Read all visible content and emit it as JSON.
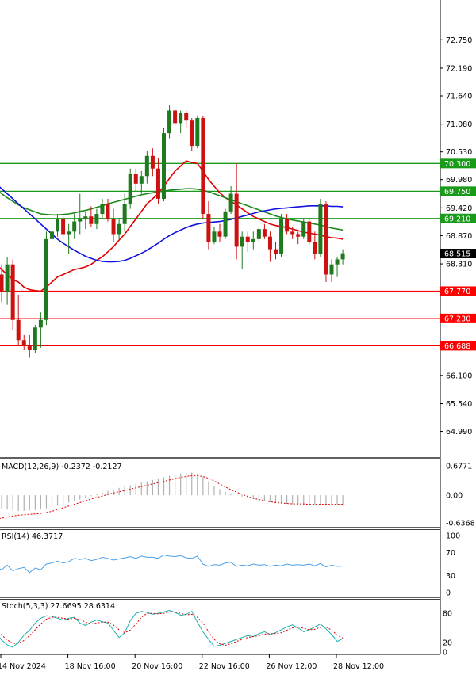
{
  "chart_data": {
    "type": "candlestick",
    "colors": {
      "up": "#1f7a1f",
      "down": "#cc1111",
      "support": "#ff0000",
      "resistance": "#1a9a1a",
      "ma_fast": "#e00000",
      "ma_slow": "#1a8a1a",
      "ma_blue": "#1010dd",
      "macd_hist": "#b0b0b0",
      "macd_signal": "#e00000",
      "rsi": "#4aa0e8",
      "stoch_main": "#1ab0b0",
      "stoch_signal": "#e00000"
    },
    "price_axis": {
      "ticks": [
        "72.750",
        "72.190",
        "71.640",
        "71.080",
        "70.530",
        "69.980",
        "69.420",
        "68.870",
        "68.310",
        "66.100",
        "65.540",
        "64.990"
      ],
      "tick_values": [
        72.75,
        72.19,
        71.64,
        71.08,
        70.53,
        69.98,
        69.42,
        68.87,
        68.31,
        66.1,
        65.54,
        64.99
      ],
      "range": [
        64.7,
        73.1
      ]
    },
    "current_price": {
      "label": "68.515",
      "value": 68.515
    },
    "levels": [
      {
        "label": "70.300",
        "value": 70.3,
        "kind": "resistance"
      },
      {
        "label": "69.750",
        "value": 69.75,
        "kind": "resistance"
      },
      {
        "label": "69.210",
        "value": 69.21,
        "kind": "resistance"
      },
      {
        "label": "67.770",
        "value": 67.77,
        "kind": "support"
      },
      {
        "label": "67.230",
        "value": 67.23,
        "kind": "support"
      },
      {
        "label": "66.688",
        "value": 66.688,
        "kind": "support"
      }
    ],
    "x_labels": [
      "14 Nov 2024",
      "18 Nov 16:00",
      "20 Nov 16:00",
      "22 Nov 16:00",
      "26 Nov 12:00",
      "28 Nov 12:00"
    ],
    "x_label_index": [
      0,
      12,
      24,
      36,
      48,
      60
    ],
    "candles": [
      [
        68.4,
        68.55,
        67.95,
        68.1
      ],
      [
        68.1,
        68.3,
        67.55,
        67.75
      ],
      [
        67.75,
        68.45,
        67.5,
        68.3
      ],
      [
        68.3,
        68.4,
        67.0,
        67.2
      ],
      [
        67.2,
        67.7,
        66.7,
        66.8
      ],
      [
        66.8,
        66.9,
        66.6,
        66.7
      ],
      [
        66.7,
        66.9,
        66.45,
        66.6
      ],
      [
        66.6,
        67.1,
        66.55,
        67.05
      ],
      [
        67.05,
        67.35,
        66.65,
        67.2
      ],
      [
        67.2,
        68.95,
        67.1,
        68.8
      ],
      [
        68.8,
        69.15,
        68.7,
        68.95
      ],
      [
        68.95,
        69.3,
        68.85,
        69.2
      ],
      [
        69.2,
        69.3,
        68.8,
        68.9
      ],
      [
        68.9,
        69.1,
        68.5,
        68.95
      ],
      [
        68.95,
        69.3,
        68.8,
        69.15
      ],
      [
        69.15,
        69.7,
        68.9,
        69.2
      ],
      [
        69.2,
        69.35,
        69.0,
        69.25
      ],
      [
        69.25,
        69.45,
        69.05,
        69.1
      ],
      [
        69.1,
        69.4,
        69.0,
        69.3
      ],
      [
        69.3,
        69.6,
        69.2,
        69.5
      ],
      [
        69.5,
        69.6,
        69.15,
        69.2
      ],
      [
        69.2,
        69.4,
        68.75,
        68.9
      ],
      [
        68.9,
        69.2,
        68.8,
        69.1
      ],
      [
        69.1,
        69.7,
        68.95,
        69.5
      ],
      [
        69.5,
        70.2,
        69.4,
        70.1
      ],
      [
        70.1,
        70.2,
        69.75,
        69.9
      ],
      [
        69.9,
        70.15,
        69.7,
        70.05
      ],
      [
        70.05,
        70.55,
        69.9,
        70.45
      ],
      [
        70.45,
        70.6,
        70.05,
        70.2
      ],
      [
        70.2,
        70.4,
        69.5,
        69.6
      ],
      [
        69.6,
        71.0,
        69.55,
        70.9
      ],
      [
        70.9,
        71.45,
        70.8,
        71.35
      ],
      [
        71.35,
        71.4,
        71.05,
        71.1
      ],
      [
        71.1,
        71.35,
        70.9,
        71.3
      ],
      [
        71.3,
        71.35,
        71.0,
        71.15
      ],
      [
        71.15,
        71.2,
        70.55,
        70.65
      ],
      [
        70.65,
        71.25,
        70.6,
        71.2
      ],
      [
        71.2,
        71.25,
        69.2,
        69.3
      ],
      [
        69.3,
        69.55,
        68.6,
        68.75
      ],
      [
        68.75,
        69.05,
        68.7,
        68.95
      ],
      [
        68.95,
        69.1,
        68.75,
        68.85
      ],
      [
        68.85,
        69.4,
        68.8,
        69.35
      ],
      [
        69.35,
        69.85,
        69.3,
        69.7
      ],
      [
        69.7,
        70.3,
        68.4,
        68.65
      ],
      [
        68.65,
        68.95,
        68.2,
        68.85
      ],
      [
        68.85,
        68.95,
        68.55,
        68.75
      ],
      [
        68.75,
        68.95,
        68.6,
        68.8
      ],
      [
        68.8,
        69.05,
        68.75,
        69.0
      ],
      [
        69.0,
        69.1,
        68.8,
        68.85
      ],
      [
        68.85,
        68.95,
        68.35,
        68.6
      ],
      [
        68.6,
        68.75,
        68.4,
        68.5
      ],
      [
        68.5,
        69.3,
        68.45,
        69.2
      ],
      [
        69.2,
        69.3,
        68.9,
        68.95
      ],
      [
        68.95,
        69.05,
        68.8,
        68.9
      ],
      [
        68.9,
        68.95,
        68.7,
        68.85
      ],
      [
        68.85,
        69.2,
        68.8,
        69.15
      ],
      [
        69.15,
        69.2,
        68.7,
        68.75
      ],
      [
        68.75,
        68.95,
        68.4,
        68.5
      ],
      [
        68.5,
        69.6,
        68.45,
        69.5
      ],
      [
        69.5,
        69.55,
        67.95,
        68.1
      ],
      [
        68.1,
        68.4,
        67.95,
        68.3
      ],
      [
        68.3,
        68.45,
        68.05,
        68.4
      ],
      [
        68.4,
        68.6,
        68.3,
        68.52
      ]
    ],
    "ma_fast": [
      68.3,
      68.2,
      68.1,
      68.0,
      67.95,
      67.85,
      67.8,
      67.78,
      67.77,
      67.85,
      67.95,
      68.05,
      68.1,
      68.15,
      68.2,
      68.22,
      68.25,
      68.3,
      68.38,
      68.45,
      68.55,
      68.65,
      68.78,
      68.9,
      69.05,
      69.2,
      69.35,
      69.5,
      69.6,
      69.7,
      69.85,
      70.0,
      70.15,
      70.25,
      70.35,
      70.32,
      70.3,
      70.15,
      69.98,
      69.85,
      69.72,
      69.62,
      69.55,
      69.48,
      69.4,
      69.32,
      69.25,
      69.2,
      69.15,
      69.1,
      69.07,
      69.05,
      69.03,
      69.0,
      68.97,
      68.94,
      68.92,
      68.9,
      68.88,
      68.85,
      68.83,
      68.82,
      68.8
    ],
    "ma_slow": [
      69.8,
      69.7,
      69.62,
      69.55,
      69.48,
      69.42,
      69.38,
      69.34,
      69.3,
      69.29,
      69.28,
      69.28,
      69.29,
      69.3,
      69.32,
      69.35,
      69.37,
      69.4,
      69.43,
      69.46,
      69.5,
      69.53,
      69.56,
      69.59,
      69.62,
      69.65,
      69.68,
      69.7,
      69.72,
      69.74,
      69.75,
      69.77,
      69.78,
      69.79,
      69.8,
      69.8,
      69.79,
      69.77,
      69.74,
      69.7,
      69.66,
      69.62,
      69.58,
      69.54,
      69.5,
      69.46,
      69.42,
      69.38,
      69.34,
      69.3,
      69.26,
      69.23,
      69.2,
      69.18,
      69.16,
      69.14,
      69.12,
      69.1,
      69.08,
      69.05,
      69.02,
      69.0,
      68.98
    ],
    "ma_blue": [
      69.9,
      69.8,
      69.7,
      69.6,
      69.5,
      69.4,
      69.3,
      69.2,
      69.1,
      69.0,
      68.9,
      68.8,
      68.72,
      68.65,
      68.58,
      68.52,
      68.46,
      68.42,
      68.38,
      68.36,
      68.35,
      68.35,
      68.36,
      68.38,
      68.42,
      68.47,
      68.52,
      68.58,
      68.65,
      68.72,
      68.8,
      68.87,
      68.93,
      68.98,
      69.03,
      69.07,
      69.1,
      69.12,
      69.13,
      69.14,
      69.15,
      69.17,
      69.19,
      69.22,
      69.25,
      69.28,
      69.31,
      69.34,
      69.36,
      69.38,
      69.4,
      69.41,
      69.42,
      69.43,
      69.44,
      69.45,
      69.46,
      69.46,
      69.46,
      69.46,
      69.45,
      69.45,
      69.44
    ],
    "macd": {
      "label": "MACD(12,26,9) -0.2372 -0.2127",
      "ticks": [
        "0.6771",
        "0.00",
        "-0.6368"
      ],
      "tick_values": [
        0.6771,
        0.0,
        -0.6368
      ],
      "histogram": [
        -0.3,
        -0.32,
        -0.33,
        -0.35,
        -0.36,
        -0.36,
        -0.35,
        -0.34,
        -0.33,
        -0.3,
        -0.27,
        -0.24,
        -0.2,
        -0.17,
        -0.14,
        -0.1,
        -0.06,
        -0.02,
        0.02,
        0.06,
        0.1,
        0.14,
        0.17,
        0.2,
        0.23,
        0.26,
        0.29,
        0.32,
        0.35,
        0.38,
        0.41,
        0.45,
        0.48,
        0.5,
        0.52,
        0.52,
        0.5,
        0.42,
        0.32,
        0.22,
        0.14,
        0.08,
        0.04,
        0.0,
        -0.03,
        -0.06,
        -0.09,
        -0.12,
        -0.14,
        -0.16,
        -0.18,
        -0.19,
        -0.2,
        -0.21,
        -0.21,
        -0.22,
        -0.22,
        -0.22,
        -0.22,
        -0.23,
        -0.23,
        -0.23,
        -0.24
      ],
      "signal": [
        -0.55,
        -0.53,
        -0.5,
        -0.48,
        -0.46,
        -0.45,
        -0.44,
        -0.43,
        -0.42,
        -0.4,
        -0.37,
        -0.33,
        -0.29,
        -0.25,
        -0.21,
        -0.17,
        -0.13,
        -0.09,
        -0.05,
        -0.02,
        0.02,
        0.05,
        0.08,
        0.11,
        0.14,
        0.17,
        0.2,
        0.23,
        0.26,
        0.29,
        0.32,
        0.35,
        0.38,
        0.41,
        0.43,
        0.45,
        0.45,
        0.43,
        0.39,
        0.33,
        0.26,
        0.19,
        0.13,
        0.07,
        0.02,
        -0.03,
        -0.07,
        -0.1,
        -0.13,
        -0.15,
        -0.17,
        -0.18,
        -0.19,
        -0.2,
        -0.2,
        -0.2,
        -0.21,
        -0.21,
        -0.21,
        -0.21,
        -0.21,
        -0.21,
        -0.21
      ]
    },
    "rsi": {
      "label": "RSI(14) 46.3717",
      "ticks": [
        "100",
        "70",
        "30",
        "0"
      ],
      "tick_values": [
        100,
        70,
        30,
        0
      ],
      "values": [
        45,
        40,
        48,
        38,
        42,
        44,
        35,
        43,
        40,
        50,
        52,
        55,
        52,
        54,
        60,
        58,
        60,
        56,
        58,
        62,
        60,
        57,
        59,
        61,
        63,
        60,
        64,
        62,
        62,
        60,
        66,
        64,
        63,
        65,
        61,
        60,
        64,
        50,
        46,
        49,
        48,
        52,
        53,
        46,
        48,
        47,
        50,
        48,
        49,
        46,
        48,
        47,
        50,
        48,
        49,
        48,
        50,
        47,
        51,
        45,
        48,
        46,
        46.37
      ]
    },
    "stoch": {
      "label": "Stoch(5,3,3) 27.6695 28.6314",
      "ticks": [
        "80",
        "20",
        "0"
      ],
      "tick_values": [
        80,
        20,
        0
      ],
      "main": [
        40,
        25,
        15,
        10,
        20,
        35,
        45,
        60,
        70,
        75,
        74,
        70,
        66,
        70,
        72,
        60,
        55,
        62,
        66,
        63,
        60,
        45,
        30,
        40,
        65,
        80,
        84,
        82,
        78,
        80,
        83,
        86,
        82,
        76,
        78,
        84,
        62,
        42,
        26,
        12,
        14,
        18,
        22,
        26,
        30,
        34,
        32,
        38,
        42,
        36,
        40,
        46,
        52,
        56,
        50,
        42,
        46,
        52,
        58,
        48,
        36,
        22,
        27.67
      ],
      "signal": [
        45,
        35,
        25,
        18,
        18,
        24,
        34,
        46,
        58,
        68,
        72,
        72,
        70,
        68,
        70,
        67,
        62,
        58,
        60,
        62,
        62,
        56,
        46,
        40,
        45,
        58,
        72,
        80,
        80,
        79,
        80,
        83,
        83,
        80,
        77,
        78,
        72,
        60,
        42,
        26,
        17,
        14,
        17,
        22,
        26,
        30,
        32,
        34,
        37,
        38,
        38,
        40,
        45,
        50,
        52,
        49,
        46,
        47,
        51,
        52,
        45,
        35,
        28.63
      ]
    }
  }
}
